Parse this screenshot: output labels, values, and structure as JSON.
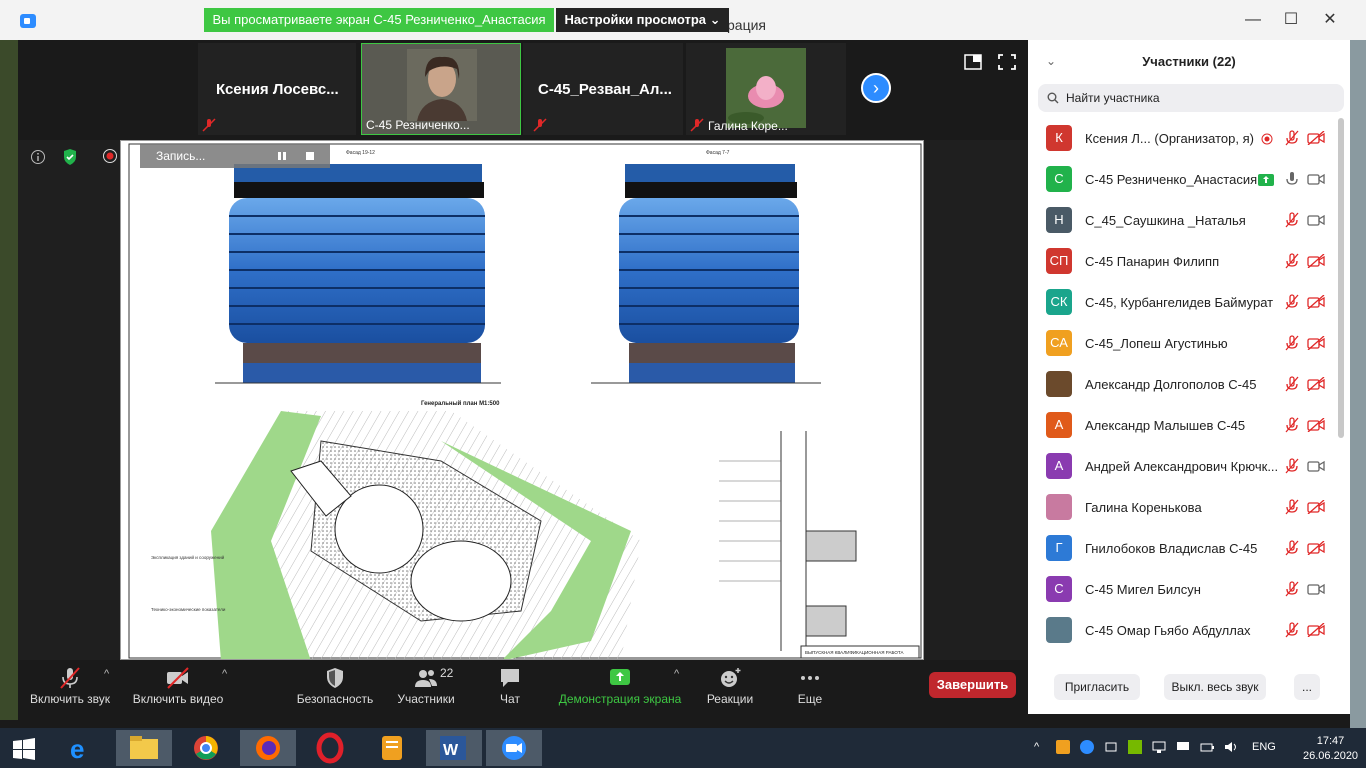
{
  "window": {
    "title": "рация",
    "share_banner": "Вы просматриваете экран С-45 Резниченко_Анастасия",
    "view_settings": "Настройки просмотра ⌄"
  },
  "gallery": {
    "tiles": [
      {
        "name": "Ксения  Лосевс..."
      },
      {
        "label": "С-45 Резниченко..."
      },
      {
        "name": "С-45_Резван_Ал..."
      },
      {
        "label": "Галина Коре..."
      }
    ]
  },
  "recording": {
    "label": "Запись..."
  },
  "toolbar": {
    "mute": "Включить звук",
    "video": "Включить видео",
    "security": "Безопасность",
    "participants": "Участники",
    "participants_count": "22",
    "chat": "Чат",
    "share": "Демонстрация экрана",
    "reactions": "Реакции",
    "more": "Еще",
    "end": "Завершить"
  },
  "panel": {
    "title": "Участники (22)",
    "search_placeholder": "Найти участника",
    "participants": [
      {
        "initials": "К",
        "color": "#d0372f",
        "name": "Ксения Л...  (Организатор, я)"
      },
      {
        "initials": "С",
        "color": "#21b24b",
        "name": "С-45 Резниченко_Анастасия"
      },
      {
        "initials": "Н",
        "color": "#4a5a66",
        "name": "С_45_Саушкина _Наталья"
      },
      {
        "initials": "СП",
        "color": "#d0372f",
        "name": "С-45 Панарин Филипп"
      },
      {
        "initials": "СК",
        "color": "#1aa58c",
        "name": "С-45, Курбангелидев Баймурат"
      },
      {
        "initials": "СА",
        "color": "#f0a020",
        "name": "С-45_Лопеш Агустинью"
      },
      {
        "initials": "",
        "color": "#6b4a2c",
        "name": "Александр Долгополов С-45"
      },
      {
        "initials": "А",
        "color": "#e05a1a",
        "name": "Александр Малышев С-45"
      },
      {
        "initials": "А",
        "color": "#8a3bb0",
        "name": "Андрей Александрович Крючк..."
      },
      {
        "initials": "",
        "color": "#c87aa0",
        "name": "Галина Коренькова"
      },
      {
        "initials": "Г",
        "color": "#2d7ad6",
        "name": "Гнилобоков Владислав С-45"
      },
      {
        "initials": "С",
        "color": "#8a3bb0",
        "name": "С-45 Мигел Билсун"
      },
      {
        "initials": "",
        "color": "#5a7a8a",
        "name": "С-45 Омар Гьябо Абдуллах"
      }
    ],
    "invite": "Пригласить",
    "mute_all": "Выкл. весь звук",
    "more": "..."
  },
  "taskbar": {
    "lang": "ENG",
    "time": "17:47",
    "date": "26.06.2020"
  },
  "drawing": {
    "facade_left": "Фасад 19-12",
    "facade_right": "Фасад 7-7",
    "plan_title": "Генеральный план М1:500",
    "stamp": "ВЫПУСКНАЯ КВАЛИФИКАЦИОННАЯ РАБОТА"
  }
}
